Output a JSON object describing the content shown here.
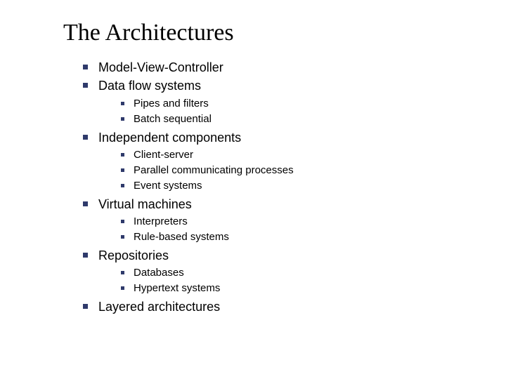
{
  "title": "The Architectures",
  "items": [
    {
      "label": "Model-View-Controller"
    },
    {
      "label": "Data flow systems",
      "children": [
        {
          "label": "Pipes and filters"
        },
        {
          "label": "Batch sequential"
        }
      ]
    },
    {
      "label": "Independent components",
      "children": [
        {
          "label": "Client-server"
        },
        {
          "label": "Parallel communicating processes"
        },
        {
          "label": "Event systems"
        }
      ]
    },
    {
      "label": "Virtual machines",
      "children": [
        {
          "label": "Interpreters"
        },
        {
          "label": "Rule-based systems"
        }
      ]
    },
    {
      "label": "Repositories",
      "children": [
        {
          "label": "Databases"
        },
        {
          "label": "Hypertext systems"
        }
      ]
    },
    {
      "label": "Layered architectures"
    }
  ]
}
